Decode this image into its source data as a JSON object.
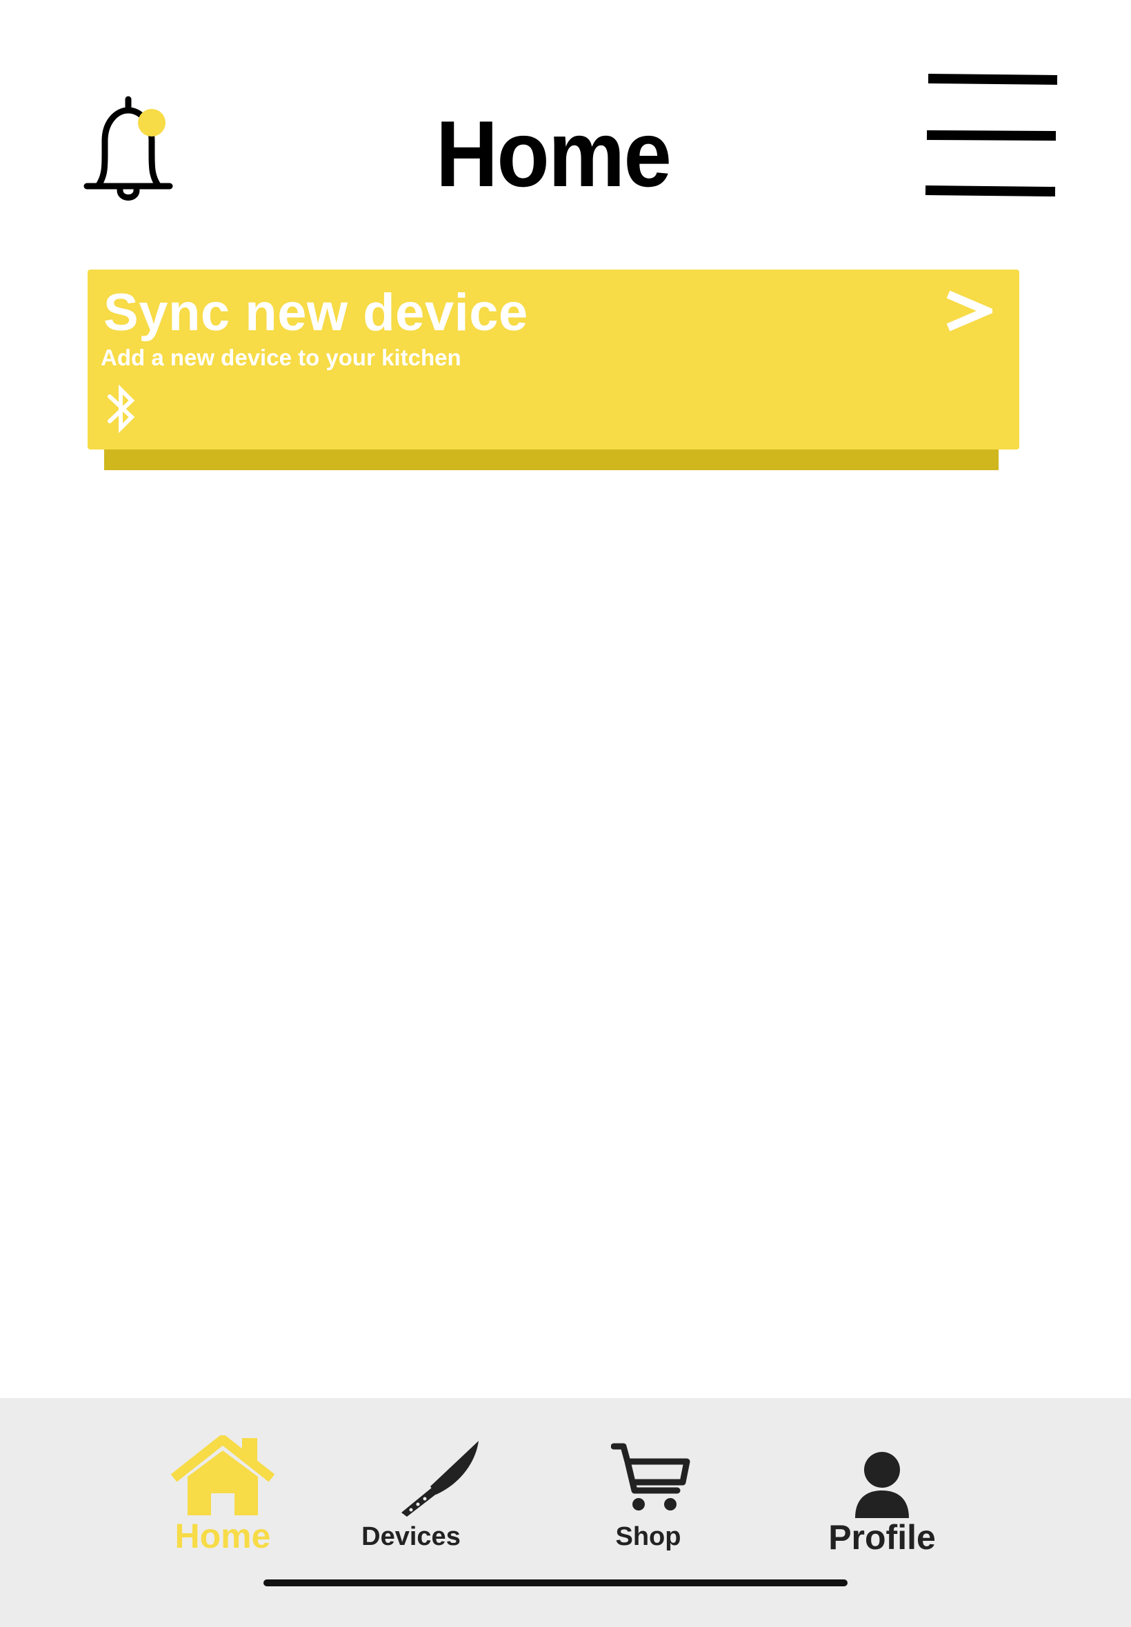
{
  "header": {
    "title": "Home",
    "notification_icon": "bell-icon",
    "notification_dot_color": "#f7db47",
    "menu_icon": "hamburger-menu-icon"
  },
  "sync_card": {
    "title": "Sync new device",
    "subtitle": "Add a new device to your kitchen",
    "chevron": ">",
    "icon": "bluetooth-icon",
    "background_color": "#f7db47"
  },
  "bottom_nav": {
    "items": [
      {
        "label": "Home",
        "icon": "home-icon",
        "active": true
      },
      {
        "label": "Devices",
        "icon": "knife-icon",
        "active": false
      },
      {
        "label": "Shop",
        "icon": "shopping-cart-icon",
        "active": false
      },
      {
        "label": "Profile",
        "icon": "profile-icon",
        "active": false
      }
    ],
    "active_color": "#f7db47",
    "inactive_color": "#222222"
  }
}
